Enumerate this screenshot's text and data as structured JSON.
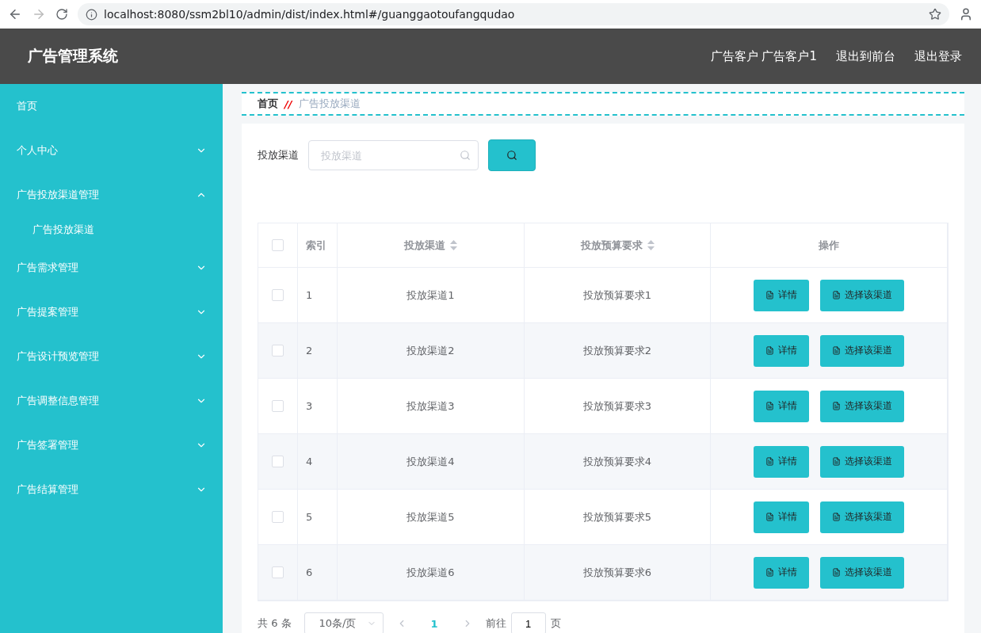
{
  "browser": {
    "url": "localhost:8080/ssm2bl10/admin/dist/index.html#/guanggaotoufangqudao"
  },
  "header": {
    "title": "广告管理系统",
    "links": [
      "广告客户 广告客户1",
      "退出到前台",
      "退出登录"
    ]
  },
  "sidebar": {
    "items": [
      {
        "label": "首页",
        "expandable": false
      },
      {
        "label": "个人中心",
        "expandable": true,
        "expanded": false
      },
      {
        "label": "广告投放渠道管理",
        "expandable": true,
        "expanded": true,
        "children": [
          {
            "label": "广告投放渠道"
          }
        ]
      },
      {
        "label": "广告需求管理",
        "expandable": true,
        "expanded": false
      },
      {
        "label": "广告提案管理",
        "expandable": true,
        "expanded": false
      },
      {
        "label": "广告设计预览管理",
        "expandable": true,
        "expanded": false
      },
      {
        "label": "广告调整信息管理",
        "expandable": true,
        "expanded": false
      },
      {
        "label": "广告签署管理",
        "expandable": true,
        "expanded": false
      },
      {
        "label": "广告结算管理",
        "expandable": true,
        "expanded": false
      }
    ]
  },
  "breadcrumb": {
    "home": "首页",
    "separator": "//",
    "current": "广告投放渠道"
  },
  "search": {
    "label": "投放渠道",
    "placeholder": "投放渠道"
  },
  "table": {
    "select_all_checked": false,
    "columns": [
      {
        "label": "索引",
        "sortable": false
      },
      {
        "label": "投放渠道",
        "sortable": true
      },
      {
        "label": "投放预算要求",
        "sortable": true
      },
      {
        "label": "操作",
        "sortable": false
      }
    ],
    "rows": [
      {
        "index": "1",
        "channel": "投放渠道1",
        "budget": "投放预算要求1",
        "checked": false,
        "actions": [
          "详情",
          "选择该渠道"
        ]
      },
      {
        "index": "2",
        "channel": "投放渠道2",
        "budget": "投放预算要求2",
        "checked": false,
        "actions": [
          "详情",
          "选择该渠道"
        ]
      },
      {
        "index": "3",
        "channel": "投放渠道3",
        "budget": "投放预算要求3",
        "checked": false,
        "actions": [
          "详情",
          "选择该渠道"
        ]
      },
      {
        "index": "4",
        "channel": "投放渠道4",
        "budget": "投放预算要求4",
        "checked": false,
        "actions": [
          "详情",
          "选择该渠道"
        ]
      },
      {
        "index": "5",
        "channel": "投放渠道5",
        "budget": "投放预算要求5",
        "checked": false,
        "actions": [
          "详情",
          "选择该渠道"
        ]
      },
      {
        "index": "6",
        "channel": "投放渠道6",
        "budget": "投放预算要求6",
        "checked": false,
        "actions": [
          "详情",
          "选择该渠道"
        ]
      }
    ]
  },
  "pagination": {
    "total": "共 6 条",
    "page_size": "10条/页",
    "pages": [
      {
        "label": "1",
        "selected": true
      }
    ],
    "goto_label": "前往",
    "goto_value": "1",
    "goto_suffix": "页"
  }
}
